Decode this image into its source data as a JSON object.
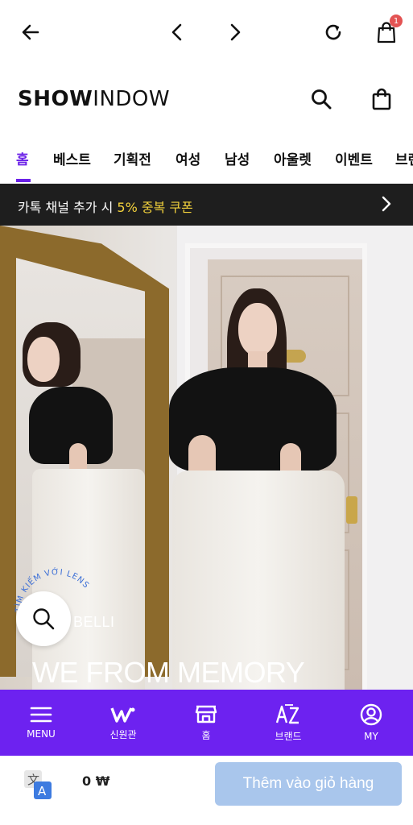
{
  "browser": {
    "cart_badge": "1"
  },
  "header": {
    "logo_bold": "SHOW",
    "logo_light": "INDOW"
  },
  "tabs": [
    {
      "label": "홈",
      "active": true
    },
    {
      "label": "베스트"
    },
    {
      "label": "기획전"
    },
    {
      "label": "여성"
    },
    {
      "label": "남성"
    },
    {
      "label": "아울렛"
    },
    {
      "label": "이벤트"
    },
    {
      "label": "브랜"
    }
  ],
  "promo": {
    "text_before": "카톡 채널 추가 시 ",
    "highlight": "5% 중복 쿠폰",
    "colors": {
      "background": "#1e1e1e",
      "highlight": "#f3d23c"
    }
  },
  "hero": {
    "subtitle": "I BELLI",
    "title": "WE FROM MEMORY",
    "curved_text": "TÌM KIẾM VỚI LENS"
  },
  "bottom_nav": {
    "items": [
      {
        "label": "MENU",
        "icon": "hamburger-icon"
      },
      {
        "label": "신원관",
        "icon": "shinwon-logo-icon"
      },
      {
        "label": "홈",
        "icon": "store-icon"
      },
      {
        "label": "브랜드",
        "icon": "az-icon"
      },
      {
        "label": "MY",
        "icon": "user-circle-icon"
      }
    ],
    "color": "#6d22f0"
  },
  "cart_bar": {
    "price": "0 ₩",
    "add_to_cart": "Thêm vào giỏ hàng",
    "button_color": "#a9c6ec"
  }
}
